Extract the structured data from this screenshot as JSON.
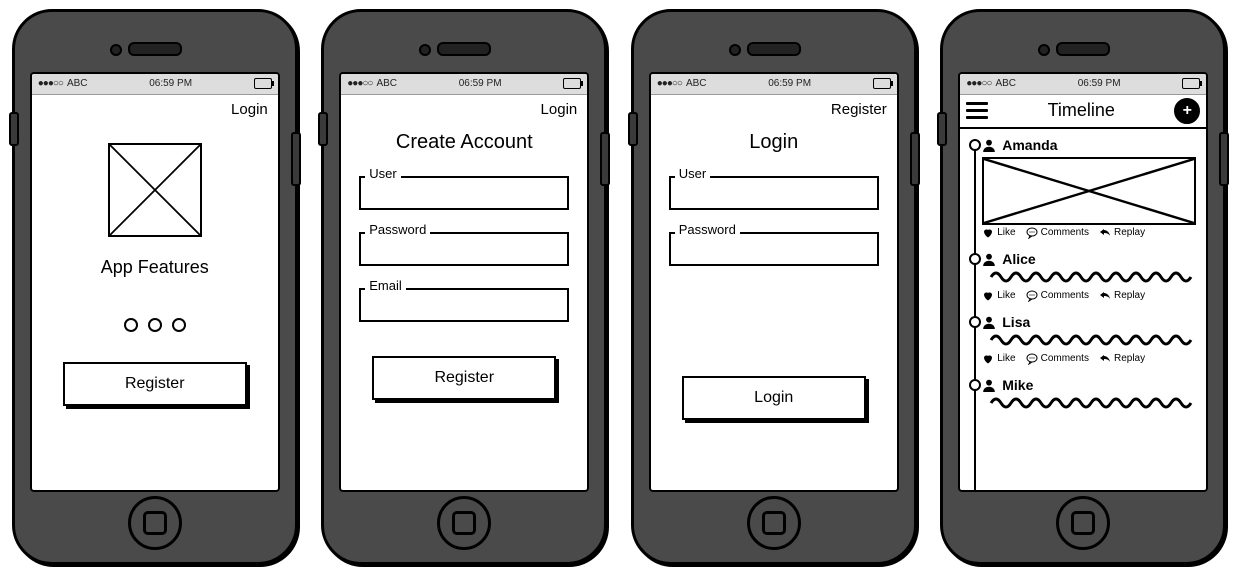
{
  "status": {
    "carrier": "ABC",
    "time": "06:59 PM",
    "signal": "●●●○○"
  },
  "screen1": {
    "toplink": "Login",
    "title": "App Features",
    "button": "Register"
  },
  "screen2": {
    "toplink": "Login",
    "title": "Create Account",
    "fields": {
      "user": "User",
      "password": "Password",
      "email": "Email"
    },
    "button": "Register"
  },
  "screen3": {
    "toplink": "Register",
    "title": "Login",
    "fields": {
      "user": "User",
      "password": "Password"
    },
    "button": "Login"
  },
  "screen4": {
    "title": "Timeline",
    "actions": {
      "like": "Like",
      "comments": "Comments",
      "replay": "Replay"
    },
    "posts": [
      {
        "name": "Amanda",
        "type": "image"
      },
      {
        "name": "Alice",
        "type": "text"
      },
      {
        "name": "Lisa",
        "type": "text"
      },
      {
        "name": "Mike",
        "type": "text"
      }
    ]
  }
}
